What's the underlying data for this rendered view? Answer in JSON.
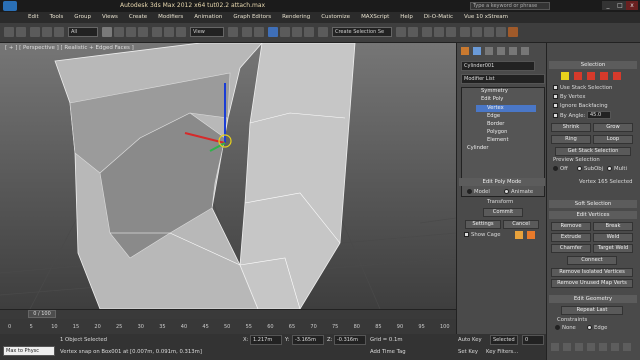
{
  "titlebar": {
    "title": "Autodesk 3ds Max  2012 x64      tut02.2 attach.max",
    "search_placeholder": "Type a keyword or phrase",
    "minimize": "_",
    "maximize": "□",
    "close": "x"
  },
  "menu": [
    "Edit",
    "Tools",
    "Group",
    "Views",
    "Create",
    "Modifiers",
    "Animation",
    "Graph Editors",
    "Rendering",
    "Customize",
    "MAXScript",
    "Help",
    "Di-O-Matic",
    "Vue 10 xStream"
  ],
  "toolbar": {
    "filter": "All",
    "view": "View",
    "create_selection": "Create Selection Se"
  },
  "viewport": {
    "label": "[ + ] [ Perspective ] [ Realistic + Edged Faces ]"
  },
  "timeslider": {
    "frame": "0 / 100"
  },
  "ruler": {
    "ticks": [
      "0",
      "5",
      "10",
      "15",
      "20",
      "25",
      "30",
      "35",
      "40",
      "45",
      "50",
      "55",
      "60",
      "65",
      "70",
      "75",
      "80",
      "85",
      "90",
      "95",
      "100"
    ]
  },
  "status": {
    "script_label": "Max to Physc",
    "objects": "1 Object Selected",
    "prompt": "Vertex snap on Box001 at [0.007m, 0.091m, 0.313m]",
    "x_label": "X:",
    "x": "1.217m",
    "y_label": "Y:",
    "y": "-3.165m",
    "z_label": "Z:",
    "z": "-0.316m",
    "grid": "Grid = 0.1m",
    "add_time_tag": "Add Time Tag"
  },
  "anim": {
    "auto_key": "Auto Key",
    "set_key": "Set Key",
    "selected": "Selected",
    "key_filters": "Key Filters...",
    "frame": "0"
  },
  "modify": {
    "object_name": "Cylinder001",
    "modifier_list": "Modifier List",
    "stack": [
      "Symmetry",
      "Edit Poly",
      "Vertex",
      "Edge",
      "Border",
      "Polygon",
      "Element",
      "Cylinder"
    ],
    "edit_poly_mode": "Edit Poly Mode",
    "model": "Model",
    "animate": "Animate",
    "transform": "Transform",
    "commit": "Commit",
    "settings": "Settings",
    "cancel": "Cancel",
    "show_cage": "Show Cage"
  },
  "selection": {
    "title": "Selection",
    "use_stack": "Use Stack Selection",
    "by_vertex": "By Vertex",
    "ignore_backfacing": "Ignore Backfacing",
    "by_angle": "By Angle:",
    "angle": "45.0",
    "shrink": "Shrink",
    "grow": "Grow",
    "ring": "Ring",
    "loop": "Loop",
    "get_stack": "Get Stack Selection",
    "preview": "Preview Selection",
    "off": "Off",
    "subobj": "SubObj",
    "multi": "Multi",
    "count": "Vertex 165 Selected"
  },
  "soft_selection": "Soft Selection",
  "edit_vertices": {
    "title": "Edit Vertices",
    "remove": "Remove",
    "break": "Break",
    "extrude": "Extrude",
    "weld": "Weld",
    "chamfer": "Chamfer",
    "target_weld": "Target Weld",
    "connect": "Connect",
    "remove_isolated": "Remove Isolated Vertices",
    "remove_unused": "Remove Unused Map Verts"
  },
  "edit_geometry": {
    "title": "Edit Geometry",
    "repeat_last": "Repeat Last",
    "constraints": "Constraints",
    "none": "None",
    "edge": "Edge"
  },
  "colors": {
    "accent": "#4a77c7",
    "red": "#d63a2b",
    "yellow": "#e8d21c",
    "green": "#2fb34a",
    "bg": "#444444"
  }
}
